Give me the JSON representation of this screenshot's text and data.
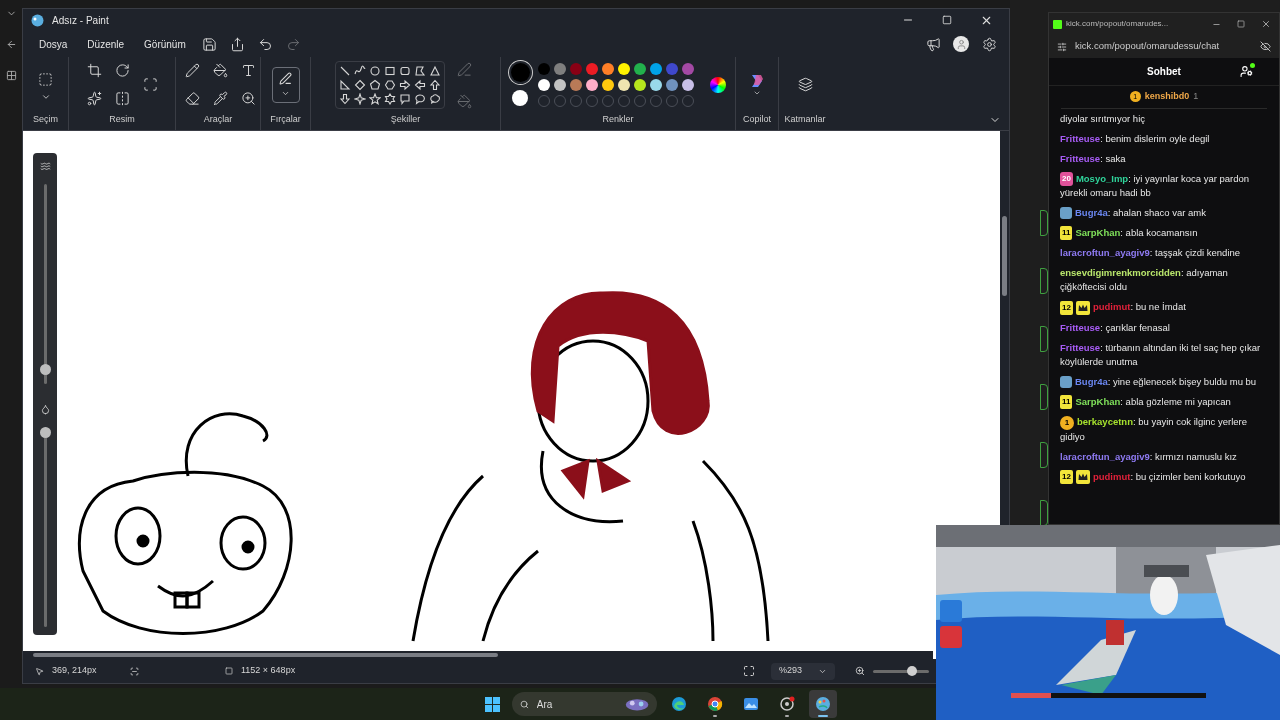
{
  "paint": {
    "title": "Adsız - Paint",
    "menu": [
      "Dosya",
      "Düzenle",
      "Görünüm"
    ],
    "groups": [
      "Seçim",
      "Resim",
      "Araçlar",
      "Fırçalar",
      "Şekiller",
      "Renkler",
      "Copilot",
      "Katmanlar"
    ],
    "current_colors": [
      {
        "color": "#000000"
      },
      {
        "color": "#ffffff"
      }
    ],
    "palette": [
      {
        "color": "#000000"
      },
      {
        "color": "#7f7f7f"
      },
      {
        "color": "#880015"
      },
      {
        "color": "#ed1c24"
      },
      {
        "color": "#ff7f27"
      },
      {
        "color": "#fff200"
      },
      {
        "color": "#22b14c"
      },
      {
        "color": "#00a2e8"
      },
      {
        "color": "#3f48cc"
      },
      {
        "color": "#a349a4"
      },
      {
        "color": "#ffffff"
      },
      {
        "color": "#c3c3c3"
      },
      {
        "color": "#b97a57"
      },
      {
        "color": "#ffaec9"
      },
      {
        "color": "#ffc90e"
      },
      {
        "color": "#efe4b0"
      },
      {
        "color": "#b5e61d"
      },
      {
        "color": "#99d9ea"
      },
      {
        "color": "#7092be"
      },
      {
        "color": "#c8bfe7"
      }
    ],
    "brush_size": {
      "level": 0.05
    },
    "opacity": {
      "level": 1
    },
    "status": {
      "position": "369, 214px",
      "size": "1152 × 648px",
      "zoom": "%293",
      "zoom_slider": {
        "level": 0.7
      }
    }
  },
  "chat": {
    "tab_title": "kick.com/popout/omarudes...",
    "address": "kick.com/popout/omarudessu/chat",
    "header": "Sohbet",
    "pinned": {
      "badge": "1",
      "user": "kenshibd0",
      "count": "1"
    },
    "messages": [
      {
        "kind": "continuation",
        "text": "diyolar sırıtmıyor hiç"
      },
      {
        "kind": "message",
        "user": "Fritteuse",
        "color": "#a75cf5",
        "text": ": benim dislerim oyle degil"
      },
      {
        "kind": "message",
        "user": "Fritteuse",
        "color": "#a75cf5",
        "text": ": saka"
      },
      {
        "kind": "message",
        "badges": [
          {
            "kind": "hex",
            "label": "20"
          }
        ],
        "user": "Mosyo_Imp",
        "color": "#2fd39a",
        "text": ": iyi yayınlar koca yar pardon yürekli omaru hadi bb"
      },
      {
        "kind": "message",
        "badges": [
          {
            "kind": "avatar"
          }
        ],
        "user": "Bugr4a",
        "color": "#6a86f0",
        "text": ": ahalan shaco var amk"
      },
      {
        "kind": "message",
        "badges": [
          {
            "kind": "square",
            "label": "11"
          }
        ],
        "user": "SarpKhan",
        "color": "#7fe05a",
        "text": ": abla kocamansın"
      },
      {
        "kind": "message",
        "user": "laracroftun_ayagiv9",
        "color": "#8e7af2",
        "text": ": taşşak çizdi kendine"
      },
      {
        "kind": "message",
        "user": "ensevdigimrenkmorcidden",
        "color": "#b9e66c",
        "text": ": adıyaman çiğköftecisi oldu"
      },
      {
        "kind": "message",
        "badges": [
          {
            "kind": "square",
            "label": "12"
          },
          {
            "kind": "crown"
          }
        ],
        "user": "pudimut",
        "color": "#e0213a",
        "text": ": bu ne İmdat"
      },
      {
        "kind": "message",
        "user": "Fritteuse",
        "color": "#a75cf5",
        "text": ": çarıklar fenasal"
      },
      {
        "kind": "message",
        "user": "Fritteuse",
        "color": "#a75cf5",
        "text": ": türbanın altından iki tel saç hep çıkar köylülerde unutma"
      },
      {
        "kind": "message",
        "badges": [
          {
            "kind": "avatar"
          }
        ],
        "user": "Bugr4a",
        "color": "#6a86f0",
        "text": ": yine eğlenecek bişey buldu mu bu"
      },
      {
        "kind": "message",
        "badges": [
          {
            "kind": "square",
            "label": "11"
          }
        ],
        "user": "SarpKhan",
        "color": "#7fe05a",
        "text": ": abla gözleme mi yapıcan"
      },
      {
        "kind": "message",
        "badges": [
          {
            "kind": "coin",
            "label": "1"
          }
        ],
        "user": "berkaycetnn",
        "color": "#a6e22e",
        "text": ": bu yayin cok ilginc yerlere gidiyo"
      },
      {
        "kind": "message",
        "user": "laracroftun_ayagiv9",
        "color": "#8e7af2",
        "text": ": kırmızı namuslu kız"
      },
      {
        "kind": "message",
        "badges": [
          {
            "kind": "square",
            "label": "12"
          },
          {
            "kind": "crown"
          }
        ],
        "user": "pudimut",
        "color": "#e0213a",
        "text": ": bu çizimler beni korkutuyo"
      }
    ]
  },
  "taskbar": {
    "search": {
      "placeholder": "Ara"
    },
    "apps": [
      {
        "kind": "edge",
        "running": false
      },
      {
        "kind": "chrome",
        "running": true
      },
      {
        "kind": "photos",
        "running": false
      },
      {
        "kind": "recorder",
        "running": true
      },
      {
        "kind": "paint",
        "running": true,
        "selected": true
      }
    ]
  }
}
